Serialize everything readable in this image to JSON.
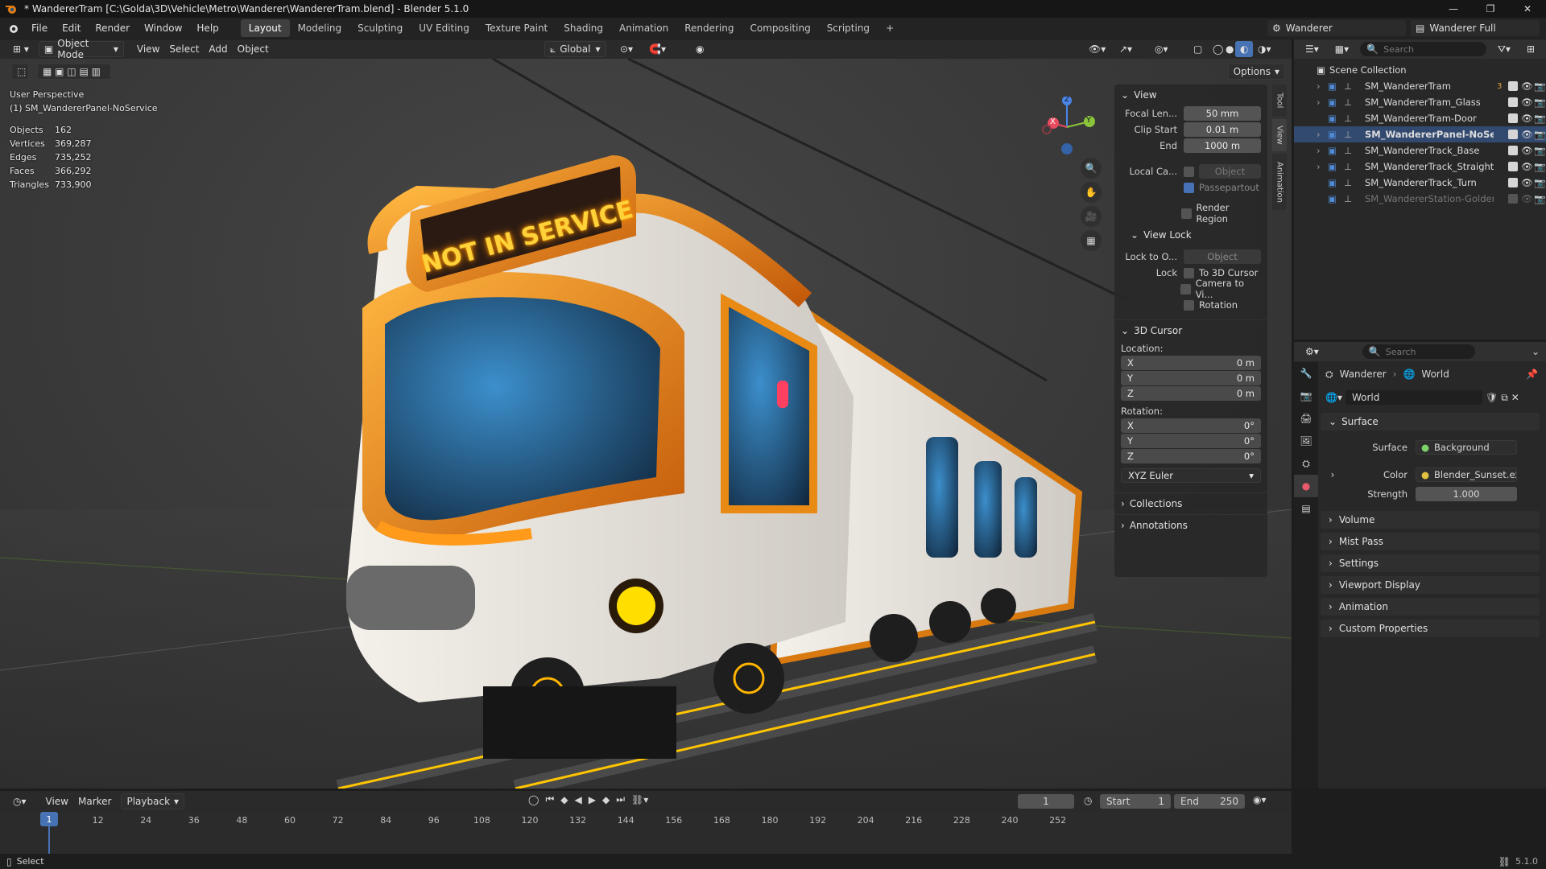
{
  "window": {
    "title": "* WandererTram [C:\\Golda\\3D\\Vehicle\\Metro\\Wanderer\\WandererTram.blend] - Blender 5.1.0"
  },
  "menu": {
    "items": [
      "File",
      "Edit",
      "Render",
      "Window",
      "Help"
    ]
  },
  "workspaces": [
    "Layout",
    "Modeling",
    "Sculpting",
    "UV Editing",
    "Texture Paint",
    "Shading",
    "Animation",
    "Rendering",
    "Compositing",
    "Scripting"
  ],
  "scene_selector": {
    "scene": "Wanderer",
    "view_layer": "Wanderer Full"
  },
  "viewport_header": {
    "mode": "Object Mode",
    "menus": [
      "View",
      "Select",
      "Add",
      "Object"
    ],
    "transform_orientation": "Global",
    "options_label": "Options"
  },
  "viewport": {
    "perspective": "User Perspective",
    "active_object": "(1) SM_WandererPanel-NoService",
    "stats": [
      {
        "label": "Objects",
        "value": "162"
      },
      {
        "label": "Vertices",
        "value": "369,287"
      },
      {
        "label": "Edges",
        "value": "735,252"
      },
      {
        "label": "Faces",
        "value": "366,292"
      },
      {
        "label": "Triangles",
        "value": "733,900"
      }
    ],
    "sign_text": "NOT IN SERVICE",
    "gizmo": {
      "x": "X",
      "y": "Y",
      "z": "Z"
    }
  },
  "npanel": {
    "tabs": [
      "Tool",
      "View",
      "Animation"
    ],
    "view": {
      "title": "View",
      "focal_label": "Focal Len...",
      "focal_value": "50 mm",
      "clip_start_label": "Clip Start",
      "clip_start_value": "0.01 m",
      "end_label": "End",
      "end_value": "1000 m",
      "local_camera_label": "Local Ca...",
      "local_camera_placeholder": "Object",
      "passepartout": "Passepartout",
      "render_region": "Render Region",
      "view_lock_title": "View Lock",
      "lock_to_label": "Lock to O...",
      "lock_to_placeholder": "Object",
      "lock_label": "Lock",
      "to_cursor": "To 3D Cursor",
      "camera_to_view": "Camera to Vi...",
      "rotation": "Rotation"
    },
    "cursor": {
      "title": "3D Cursor",
      "location_label": "Location:",
      "loc": [
        {
          "axis": "X",
          "value": "0 m"
        },
        {
          "axis": "Y",
          "value": "0 m"
        },
        {
          "axis": "Z",
          "value": "0 m"
        }
      ],
      "rotation_label": "Rotation:",
      "rot": [
        {
          "axis": "X",
          "value": "0°"
        },
        {
          "axis": "Y",
          "value": "0°"
        },
        {
          "axis": "Z",
          "value": "0°"
        }
      ],
      "rotation_mode": "XYZ Euler"
    },
    "collapsed": [
      "Collections",
      "Annotations"
    ]
  },
  "outliner": {
    "search_placeholder": "Search",
    "root": "Scene Collection",
    "items": [
      {
        "name": "SM_WandererTram",
        "expand": true,
        "bold": false,
        "enabled": true,
        "extra": "3"
      },
      {
        "name": "SM_WandererTram_Glass",
        "expand": true,
        "bold": false,
        "enabled": true,
        "extra": ""
      },
      {
        "name": "SM_WandererTram-Door",
        "expand": false,
        "bold": false,
        "enabled": true,
        "extra": ""
      },
      {
        "name": "SM_WandererPanel-NoService",
        "expand": true,
        "bold": true,
        "enabled": true,
        "extra": ""
      },
      {
        "name": "SM_WandererTrack_Base",
        "expand": true,
        "bold": false,
        "enabled": true,
        "extra": ""
      },
      {
        "name": "SM_WandererTrack_Straight",
        "expand": true,
        "bold": false,
        "enabled": true,
        "extra": ""
      },
      {
        "name": "SM_WandererTrack_Turn",
        "expand": false,
        "bold": false,
        "enabled": true,
        "extra": ""
      },
      {
        "name": "SM_WandererStation-Golden",
        "expand": false,
        "bold": false,
        "enabled": false,
        "extra": ""
      }
    ]
  },
  "properties": {
    "search_placeholder": "Search",
    "breadcrumb": [
      "Wanderer",
      "World"
    ],
    "world_name": "World",
    "surface": {
      "title": "Surface",
      "surface_label": "Surface",
      "surface_value": "Background",
      "color_label": "Color",
      "color_value": "Blender_Sunset.exr",
      "strength_label": "Strength",
      "strength_value": "1.000"
    },
    "sections": [
      "Volume",
      "Mist Pass",
      "Settings",
      "Viewport Display",
      "Animation",
      "Custom Properties"
    ]
  },
  "timeline": {
    "menus": [
      "View",
      "Marker",
      "Playback"
    ],
    "current_frame": "1",
    "start_label": "Start",
    "start_value": "1",
    "end_label": "End",
    "end_value": "250",
    "playhead": "1",
    "ticks": [
      "12",
      "24",
      "36",
      "48",
      "60",
      "72",
      "84",
      "96",
      "108",
      "120",
      "132",
      "144",
      "156",
      "168",
      "180",
      "192",
      "204",
      "216",
      "228",
      "240",
      "252"
    ]
  },
  "statusbar": {
    "left": "Select",
    "version": "5.1.0"
  },
  "colors": {
    "accent": "#4772b3",
    "header": "#303030",
    "panel": "#282828",
    "playhead": "#4772b3"
  }
}
